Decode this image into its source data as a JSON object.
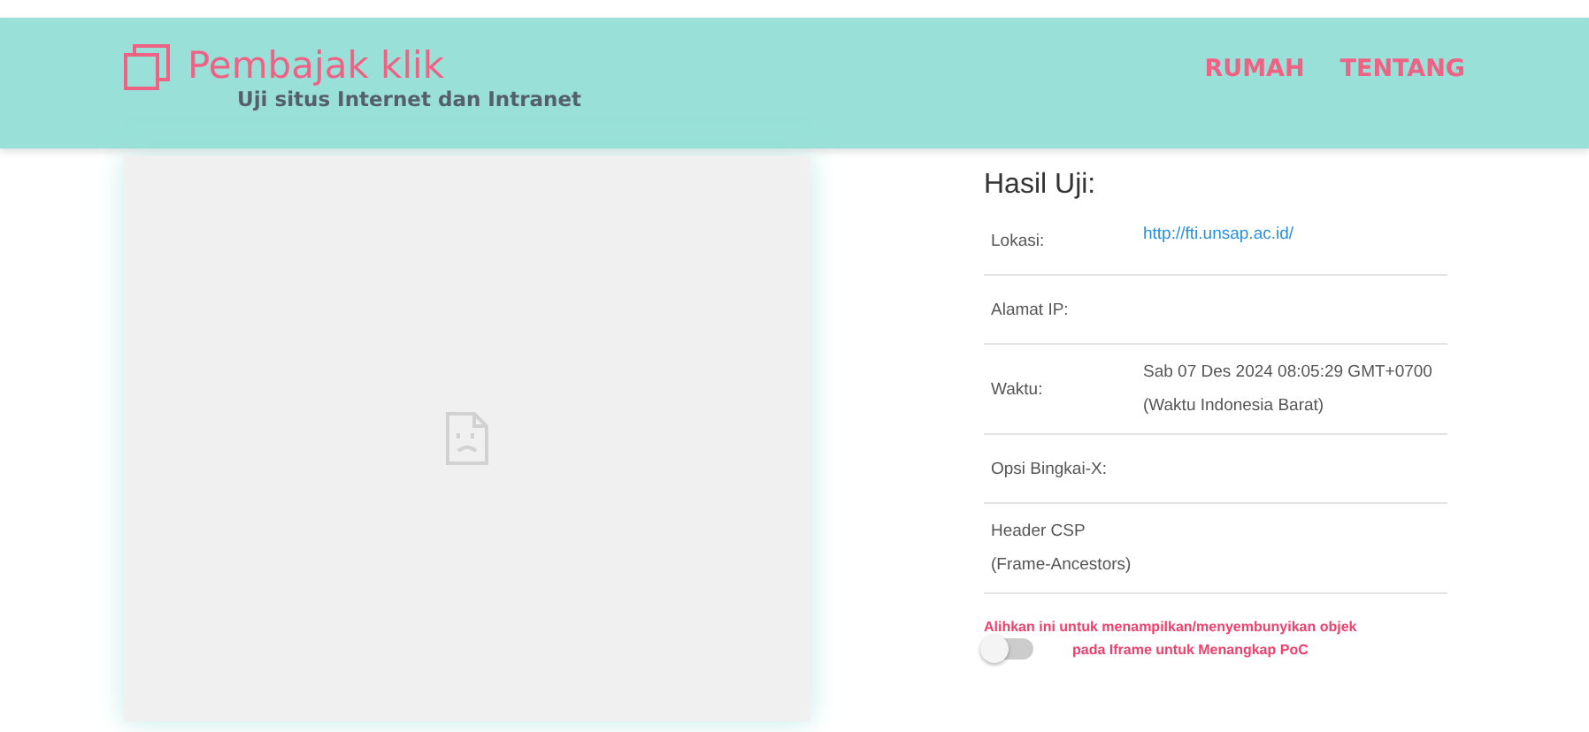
{
  "header": {
    "title": "Pembajak klik",
    "subtitle": "Uji situs Internet dan Intranet",
    "nav": [
      {
        "label": "RUMAH"
      },
      {
        "label": "TENTANG"
      }
    ]
  },
  "results": {
    "heading": "Hasil Uji:",
    "rows": [
      {
        "label": "Lokasi:",
        "value": "http://fti.unsap.ac.id/",
        "kind": "link"
      },
      {
        "label": "Alamat IP:"
      },
      {
        "label": "Waktu:",
        "value": "Sab 07 Des 2024 08:05:29 GMT+0700 (Waktu Indonesia Barat)",
        "kind": "text"
      },
      {
        "label": "Opsi Bingkai-X:"
      },
      {
        "label": "Header CSP (Frame-Ancestors)"
      }
    ]
  },
  "toggle": {
    "hint": "Alihkan ini untuk menampilkan/menyembunyikan objek",
    "caption": "pada Iframe untuk Menangkap PoC",
    "on": false
  }
}
